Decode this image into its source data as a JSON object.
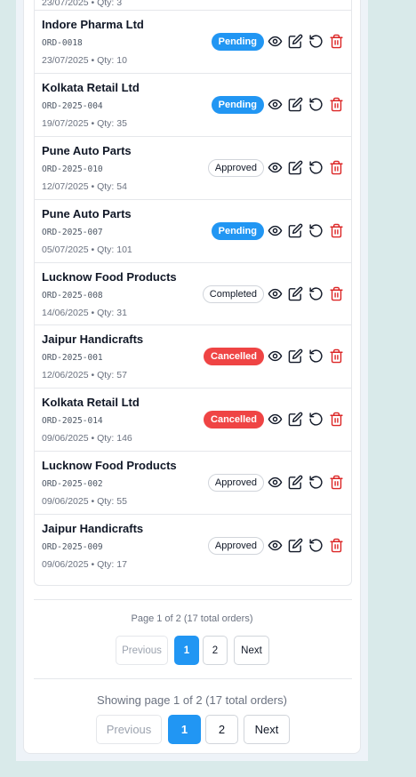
{
  "orders": [
    {
      "customer": "",
      "code": "",
      "date": "23/07/2025",
      "qty": "3",
      "status": "",
      "partial": true
    },
    {
      "customer": "Indore Pharma Ltd",
      "code": "ORD-0018",
      "date": "23/07/2025",
      "qty": "10",
      "status": "Pending"
    },
    {
      "customer": "Kolkata Retail Ltd",
      "code": "ORD-2025-004",
      "date": "19/07/2025",
      "qty": "35",
      "status": "Pending"
    },
    {
      "customer": "Pune Auto Parts",
      "code": "ORD-2025-010",
      "date": "12/07/2025",
      "qty": "54",
      "status": "Approved"
    },
    {
      "customer": "Pune Auto Parts",
      "code": "ORD-2025-007",
      "date": "05/07/2025",
      "qty": "101",
      "status": "Pending"
    },
    {
      "customer": "Lucknow Food Products",
      "code": "ORD-2025-008",
      "date": "14/06/2025",
      "qty": "31",
      "status": "Completed"
    },
    {
      "customer": "Jaipur Handicrafts",
      "code": "ORD-2025-001",
      "date": "12/06/2025",
      "qty": "57",
      "status": "Cancelled"
    },
    {
      "customer": "Kolkata Retail Ltd",
      "code": "ORD-2025-014",
      "date": "09/06/2025",
      "qty": "146",
      "status": "Cancelled"
    },
    {
      "customer": "Lucknow Food Products",
      "code": "ORD-2025-002",
      "date": "09/06/2025",
      "qty": "55",
      "status": "Approved"
    },
    {
      "customer": "Jaipur Handicrafts",
      "code": "ORD-2025-009",
      "date": "09/06/2025",
      "qty": "17",
      "status": "Approved"
    }
  ],
  "meta_separator": " • Qty: ",
  "icons": {
    "view": "eye-icon",
    "edit": "edit-icon",
    "reset": "rotate-ccw-icon",
    "delete": "trash-icon"
  },
  "colors": {
    "pending": "#2196f3",
    "cancelled": "#ef4444",
    "delete_icon": "#dc2626",
    "page_active": "#2196f3"
  },
  "pagination_small": {
    "info": "Page 1 of 2 (17 total orders)",
    "previous_label": "Previous",
    "pages": [
      "1",
      "2"
    ],
    "next_label": "Next",
    "current": "1"
  },
  "pagination_large": {
    "info": "Showing page 1 of 2 (17 total orders)",
    "previous_label": "Previous",
    "pages": [
      "1",
      "2"
    ],
    "next_label": "Next",
    "current": "1"
  }
}
